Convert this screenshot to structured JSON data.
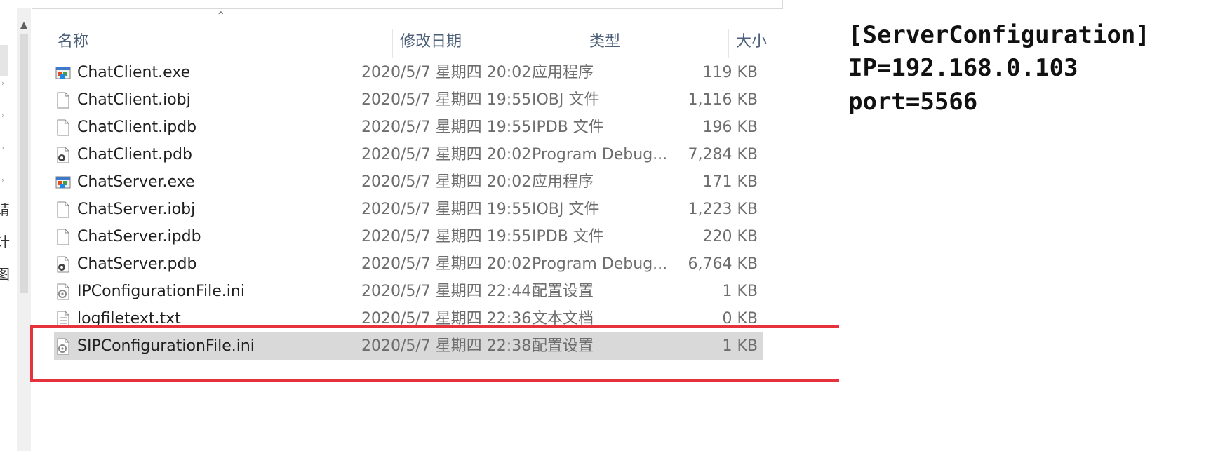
{
  "columns": {
    "name": "名称",
    "date": "修改日期",
    "type": "类型",
    "size": "大小"
  },
  "nav_fragments": [
    "请",
    "计",
    "图"
  ],
  "files": [
    {
      "name": "ChatClient.exe",
      "date": "2020/5/7 星期四 20:02",
      "type": "应用程序",
      "size": "119 KB",
      "icon": "exe-icon"
    },
    {
      "name": "ChatClient.iobj",
      "date": "2020/5/7 星期四 19:55",
      "type": "IOBJ 文件",
      "size": "1,116 KB",
      "icon": "file-icon"
    },
    {
      "name": "ChatClient.ipdb",
      "date": "2020/5/7 星期四 19:55",
      "type": "IPDB 文件",
      "size": "196 KB",
      "icon": "file-icon"
    },
    {
      "name": "ChatClient.pdb",
      "date": "2020/5/7 星期四 20:02",
      "type": "Program Debug...",
      "size": "7,284 KB",
      "icon": "pdb-icon"
    },
    {
      "name": "ChatServer.exe",
      "date": "2020/5/7 星期四 20:02",
      "type": "应用程序",
      "size": "171 KB",
      "icon": "exe-icon"
    },
    {
      "name": "ChatServer.iobj",
      "date": "2020/5/7 星期四 19:55",
      "type": "IOBJ 文件",
      "size": "1,223 KB",
      "icon": "file-icon"
    },
    {
      "name": "ChatServer.ipdb",
      "date": "2020/5/7 星期四 19:55",
      "type": "IPDB 文件",
      "size": "220 KB",
      "icon": "file-icon"
    },
    {
      "name": "ChatServer.pdb",
      "date": "2020/5/7 星期四 20:02",
      "type": "Program Debug...",
      "size": "6,764 KB",
      "icon": "pdb-icon"
    },
    {
      "name": "IPConfigurationFile.ini",
      "date": "2020/5/7 星期四 22:44",
      "type": "配置设置",
      "size": "1 KB",
      "icon": "ini-icon"
    },
    {
      "name": "logfiletext.txt",
      "date": "2020/5/7 星期四 22:36",
      "type": "文本文档",
      "size": "0 KB",
      "icon": "txt-icon"
    },
    {
      "name": "SIPConfigurationFile.ini",
      "date": "2020/5/7 星期四 22:38",
      "type": "配置设置",
      "size": "1 KB",
      "icon": "ini-icon",
      "selected": true
    }
  ],
  "preview": {
    "lines": [
      "[ServerConfiguration]",
      "IP=192.168.0.103",
      "port=5566"
    ]
  },
  "colors": {
    "annotation": "#e5323c",
    "selected_row": "#d9d9d9",
    "header_text": "#4c607a"
  }
}
